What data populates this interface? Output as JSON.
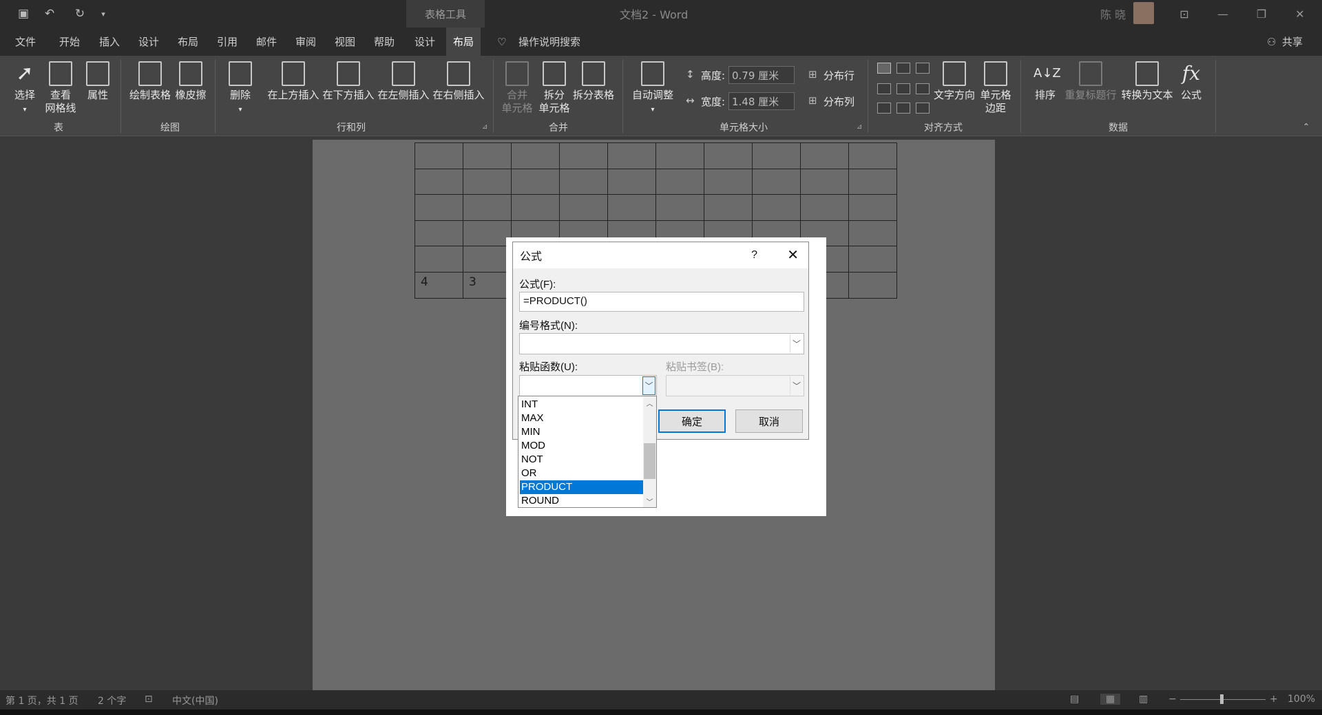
{
  "window": {
    "doc_title": "文档2 - Word",
    "tool_tab_title": "表格工具",
    "user_name": "陈 晓"
  },
  "quick_access": {
    "save_icon": "save-icon",
    "undo_icon": "undo-icon",
    "redo_icon": "redo-icon",
    "customize_icon": "customize-icon"
  },
  "menu": {
    "items": [
      "文件",
      "开始",
      "插入",
      "设计",
      "布局",
      "引用",
      "邮件",
      "审阅",
      "视图",
      "帮助",
      "设计",
      "布局"
    ],
    "search": "操作说明搜索",
    "share": "共享"
  },
  "ribbon": {
    "table": {
      "select": "选择",
      "gridlines": "查看\n网格线",
      "properties": "属性",
      "group": "表"
    },
    "draw": {
      "draw_table": "绘制表格",
      "eraser": "橡皮擦",
      "group": "绘图"
    },
    "rows_cols": {
      "delete": "删除",
      "insert_above": "在上方插入",
      "insert_below": "在下方插入",
      "insert_left": "在左侧插入",
      "insert_right": "在右侧插入",
      "group": "行和列"
    },
    "merge": {
      "merge_cells": "合并\n单元格",
      "split_cells": "拆分\n单元格",
      "split_table": "拆分表格",
      "group": "合并"
    },
    "cell_size": {
      "autofit": "自动调整",
      "height_label": "高度:",
      "height_value": "0.79 厘米",
      "width_label": "宽度:",
      "width_value": "1.48 厘米",
      "distribute_rows": "分布行",
      "distribute_cols": "分布列",
      "group": "单元格大小"
    },
    "alignment": {
      "text_direction": "文字方向",
      "cell_margins": "单元格\n边距",
      "group": "对齐方式"
    },
    "data": {
      "sort": "排序",
      "repeat_header": "重复标题行",
      "convert_text": "转换为文本",
      "formula": "公式",
      "group": "数据"
    }
  },
  "table": {
    "last_row": [
      "4",
      "3",
      "",
      "",
      "",
      "",
      "",
      "",
      "",
      ""
    ]
  },
  "dialog": {
    "title": "公式",
    "help": "?",
    "close": "✕",
    "formula_label": "公式(F):",
    "formula_value": "=PRODUCT()",
    "number_format_label": "编号格式(N):",
    "number_format_value": "",
    "paste_function_label": "粘贴函数(U):",
    "paste_bookmark_label": "粘贴书签(B):",
    "ok": "确定",
    "cancel": "取消"
  },
  "function_list": {
    "items": [
      "INT",
      "MAX",
      "MIN",
      "MOD",
      "NOT",
      "OR",
      "PRODUCT",
      "ROUND"
    ],
    "selected": "PRODUCT"
  },
  "status": {
    "page": "第 1 页，共 1 页",
    "words": "2 个字",
    "language": "中文(中国)",
    "zoom": "100%"
  }
}
